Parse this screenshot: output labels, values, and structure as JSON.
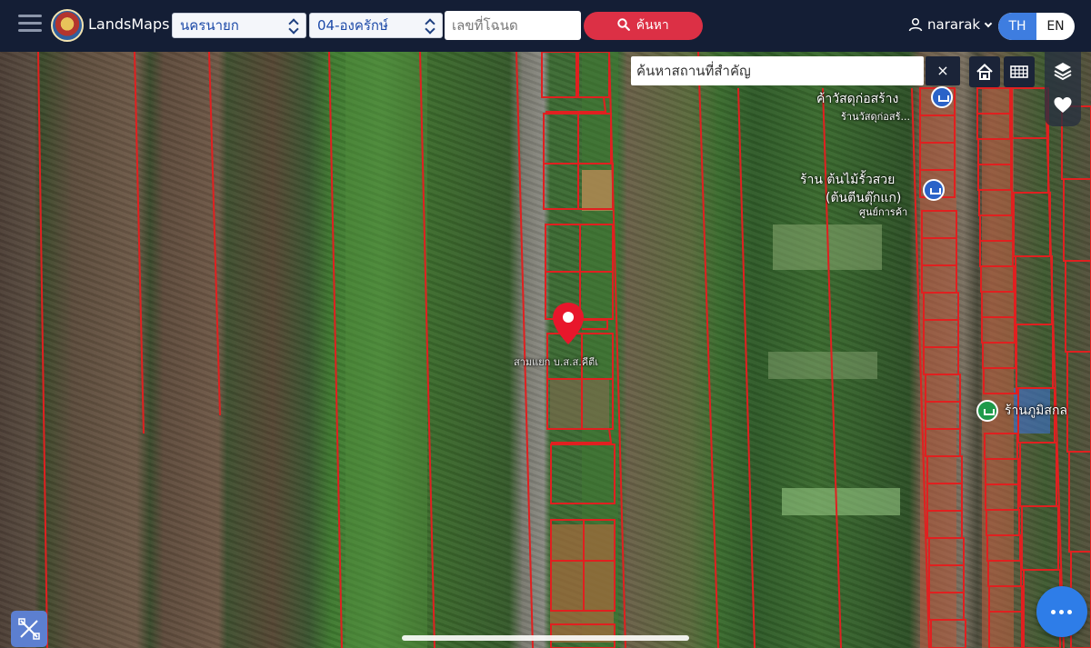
{
  "header": {
    "brand": "LandsMaps",
    "province": "นครนายก",
    "district": "04-องครักษ์",
    "deed_placeholder": "เลขที่โฉนด",
    "search_label": "ค้นหา",
    "user": "nararak",
    "lang_th": "TH",
    "lang_en": "EN"
  },
  "map": {
    "place_search_placeholder": "ค้นหาสถานที่สำคัญ",
    "clear_label": "×",
    "labels": {
      "l1": "ค้าวัสดุก่อสร้าง",
      "l2": "ร้านวัสดุก่อสร้...",
      "l3": "ร้าน ต้นไม้รั้วสวย",
      "l4": "(ต้นตีนตุ๊กแก)",
      "l5": "ศูนย์การค้า",
      "l6": "ร้านภูมิสกล",
      "pin_label": "สามแยก บ.ส.ส.คีตีเ"
    }
  },
  "colors": {
    "topbar": "#141e35",
    "accent_red": "#dc3045",
    "lang_active": "#3e7de0",
    "parcel_line": "#e02020",
    "fab": "#2e7de8"
  },
  "icons": [
    "hamburger-icon",
    "landsmaps-logo",
    "search-icon",
    "user-icon",
    "close-icon",
    "home-icon",
    "grid-icon",
    "layers-icon",
    "heart-icon",
    "map-pin-icon",
    "tools-icon",
    "more-icon"
  ]
}
